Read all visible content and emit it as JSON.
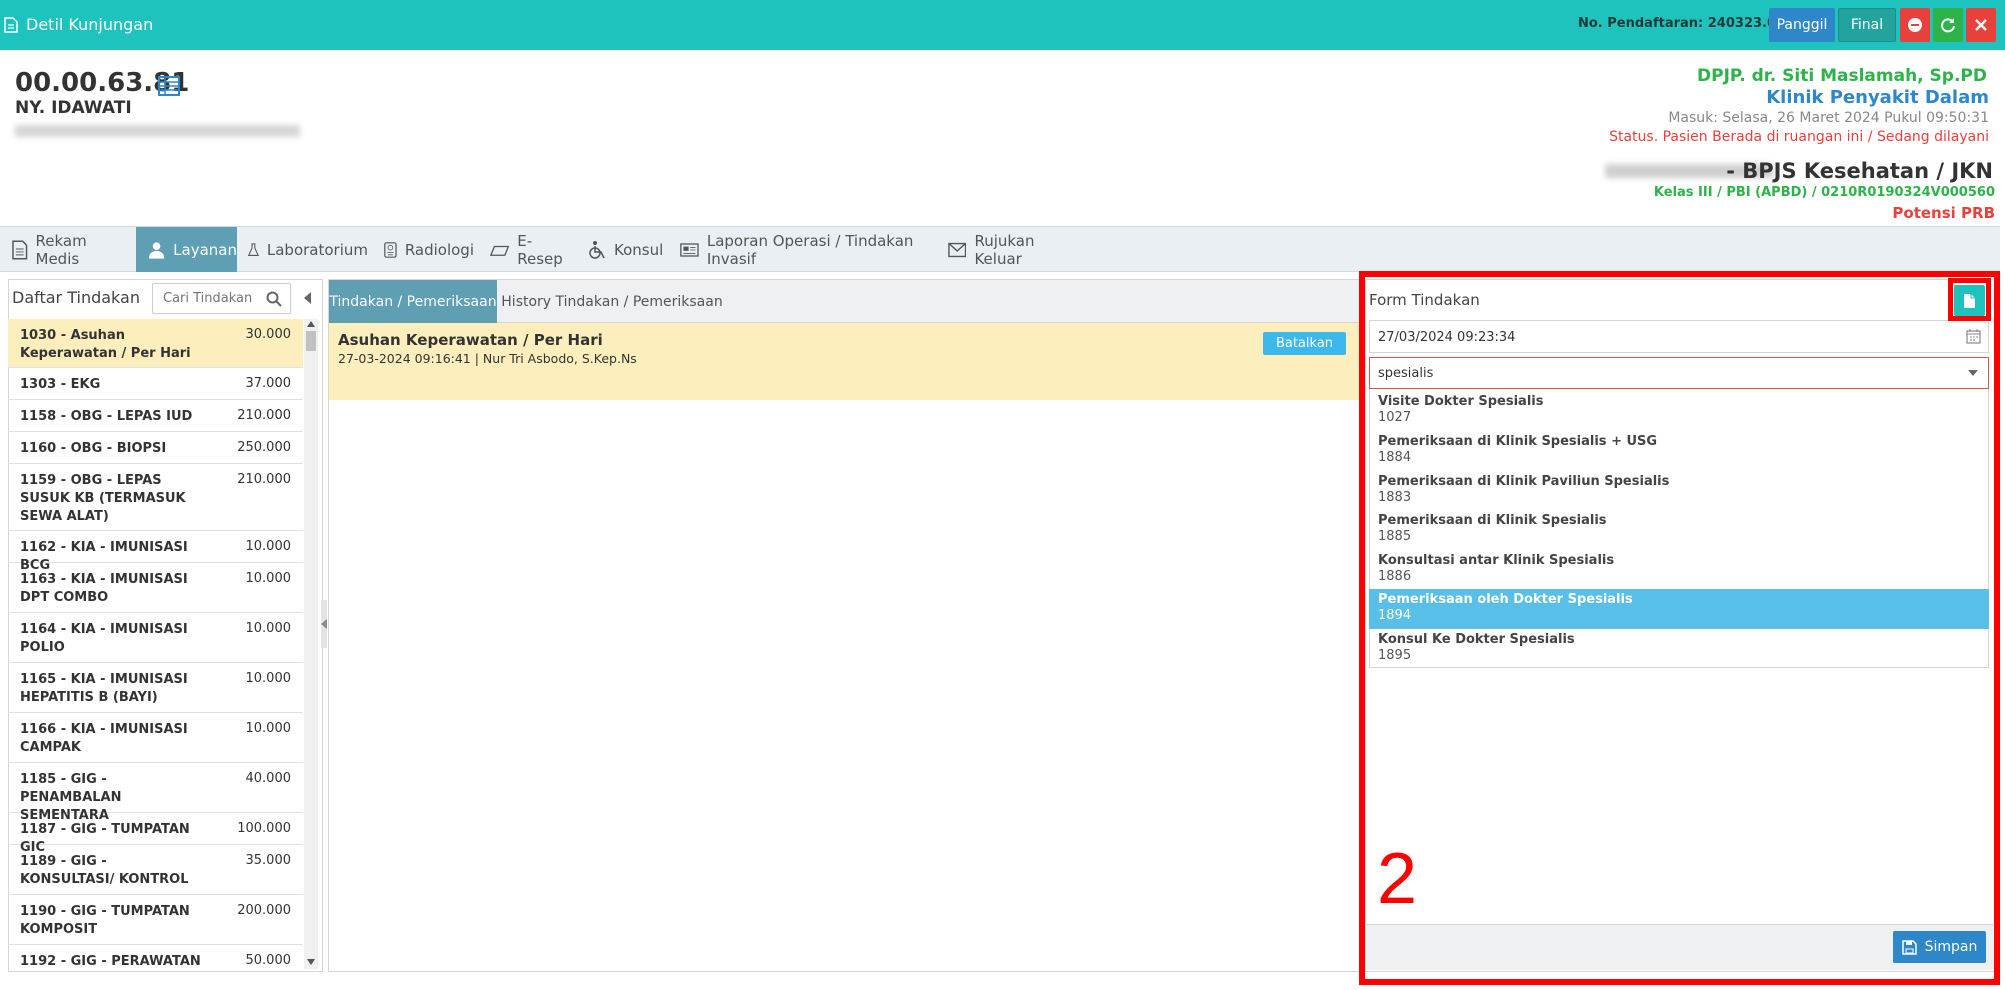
{
  "app": {
    "title": "Detil Kunjungan",
    "registration": "No. Pendaftaran: 240323.0016",
    "buttons": {
      "call": "Panggil",
      "final": "Final"
    }
  },
  "patient": {
    "rm": "00.00.63.81",
    "name": "NY. IDAWATI"
  },
  "visit": {
    "doctor": "DPJP. dr. Siti Maslamah, Sp.PD",
    "clinic": "Klinik Penyakit Dalam",
    "entry": "Masuk: Selasa, 26 Maret 2024 Pukul 09:50:31",
    "status": "Status. Pasien Berada di ruangan ini / Sedang dilayani",
    "insurance": "- BPJS Kesehatan / JKN",
    "class_info": "Kelas III / PBI (APBD) / 0210R0190324V000560",
    "potensi": "Potensi PRB"
  },
  "tabs": [
    {
      "label": "Rekam Medis"
    },
    {
      "label": "Layanan"
    },
    {
      "label": "Laboratorium"
    },
    {
      "label": "Radiologi"
    },
    {
      "label": "E-Resep"
    },
    {
      "label": "Konsul"
    },
    {
      "label": "Laporan Operasi / Tindakan Invasif"
    },
    {
      "label": "Rujukan Keluar"
    }
  ],
  "left": {
    "title": "Daftar Tindakan",
    "search_placeholder": "Cari Tindakan",
    "items": [
      {
        "name": "1030 - Asuhan Keperawatan / Per Hari",
        "price": "30.000"
      },
      {
        "name": "1303 - EKG",
        "price": "37.000"
      },
      {
        "name": "1158 - OBG - LEPAS IUD",
        "price": "210.000"
      },
      {
        "name": "1160 - OBG - BIOPSI",
        "price": "250.000"
      },
      {
        "name": "1159 - OBG - LEPAS SUSUK KB (TERMASUK SEWA ALAT)",
        "price": "210.000"
      },
      {
        "name": "1162 - KIA - IMUNISASI BCG",
        "price": "10.000"
      },
      {
        "name": "1163 - KIA - IMUNISASI DPT COMBO",
        "price": "10.000"
      },
      {
        "name": "1164 - KIA - IMUNISASI POLIO",
        "price": "10.000"
      },
      {
        "name": "1165 - KIA - IMUNISASI HEPATITIS B (BAYI)",
        "price": "10.000"
      },
      {
        "name": "1166 - KIA - IMUNISASI CAMPAK",
        "price": "10.000"
      },
      {
        "name": "1185 - GIG - PENAMBALAN SEMENTARA",
        "price": "40.000"
      },
      {
        "name": "1187 - GIG - TUMPATAN GIC",
        "price": "100.000"
      },
      {
        "name": "1189 - GIG - KONSULTASI/ KONTROL",
        "price": "35.000"
      },
      {
        "name": "1190 - GIG - TUMPATAN KOMPOSIT",
        "price": "200.000"
      },
      {
        "name": "1192 - GIG - PERAWATAN",
        "price": "50.000"
      }
    ]
  },
  "middle": {
    "tabs": [
      "Tindakan / Pemeriksaan",
      "History Tindakan / Pemeriksaan"
    ],
    "entry": {
      "title": "Asuhan Keperawatan / Per Hari",
      "meta": "27-03-2024 09:16:41 | Nur Tri Asbodo, S.Kep.Ns",
      "cancel": "Batalkan"
    }
  },
  "form": {
    "title": "Form Tindakan",
    "datetime": "27/03/2024 09:23:34",
    "search_value": "spesialis",
    "options": [
      {
        "name": "Visite Dokter Spesialis",
        "code": "1027"
      },
      {
        "name": "Pemeriksaan di Klinik Spesialis + USG",
        "code": "1884"
      },
      {
        "name": "Pemeriksaan di Klinik Paviliun Spesialis",
        "code": "1883"
      },
      {
        "name": "Pemeriksaan di Klinik Spesialis",
        "code": "1885"
      },
      {
        "name": "Konsultasi antar Klinik Spesialis",
        "code": "1886"
      },
      {
        "name": "Pemeriksaan oleh Dokter Spesialis",
        "code": "1894"
      },
      {
        "name": "Konsul Ke Dokter Spesialis",
        "code": "1895"
      }
    ],
    "save": "Simpan"
  },
  "annotation": {
    "number": "2"
  },
  "colors": {
    "teal": "#1ec3bd",
    "blue": "#2e87c8",
    "red": "#e8413c",
    "green": "#2db34a",
    "highlight": "#57bfe8"
  }
}
